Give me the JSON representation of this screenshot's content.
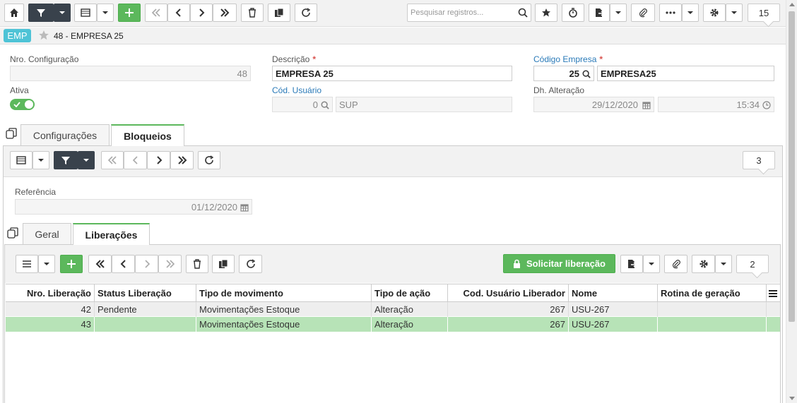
{
  "toolbar": {
    "search_placeholder": "Pesquisar registros...",
    "record_count": "15"
  },
  "header": {
    "badge": "EMP",
    "title": "48 - EMPRESA 25"
  },
  "form": {
    "nro_config_label": "Nro. Configuração",
    "nro_config_value": "48",
    "descricao_label": "Descrição",
    "descricao_value": "EMPRESA 25",
    "cod_empresa_label": "Código Empresa",
    "cod_empresa_value": "25",
    "empresa_name_value": "EMPRESA25",
    "ativa_label": "Ativa",
    "cod_usuario_label": "Cód. Usuário",
    "cod_usuario_value": "0",
    "usuario_name_value": "SUP",
    "dh_alteracao_label": "Dh. Alteração",
    "dh_date_value": "29/12/2020",
    "dh_time_value": "15:34",
    "required_mark": "*"
  },
  "tabs_main": [
    {
      "label": "Configurações",
      "active": false
    },
    {
      "label": "Bloqueios",
      "active": true
    }
  ],
  "bloqueios": {
    "count": "3",
    "referencia_label": "Referência",
    "referencia_value": "01/12/2020"
  },
  "tabs_sub": [
    {
      "label": "Geral",
      "active": false
    },
    {
      "label": "Liberações",
      "active": true
    }
  ],
  "liberacoes": {
    "solicitar_label": "Solicitar liberação",
    "count": "2",
    "columns": [
      "Nro. Liberação",
      "Status Liberação",
      "Tipo de movimento",
      "Tipo de ação",
      "Cod. Usuário Liberador",
      "Nome",
      "Rotina de geração"
    ],
    "rows": [
      [
        "42",
        "Pendente",
        "Movimentações Estoque",
        "Alteração",
        "267",
        "USU-267",
        ""
      ],
      [
        "43",
        "",
        "Movimentações Estoque",
        "Alteração",
        "267",
        "USU-267",
        ""
      ]
    ]
  },
  "colors": {
    "accent_green": "#5cb85c",
    "badge_teal": "#4ec3d6",
    "selected_row": "#b7e3b7",
    "dark_button": "#39424c"
  }
}
